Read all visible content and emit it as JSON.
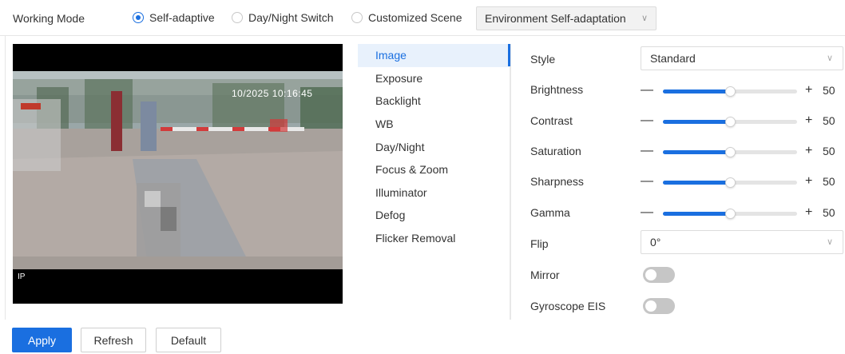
{
  "working_mode": {
    "label": "Working Mode",
    "options": [
      {
        "label": "Self-adaptive",
        "checked": true
      },
      {
        "label": "Day/Night Switch",
        "checked": false
      },
      {
        "label": "Customized Scene",
        "checked": false
      }
    ],
    "scene_select": "Environment Self-adaptation"
  },
  "video": {
    "osd_time": "10/2025 10:16:45",
    "osd_ip": "IP"
  },
  "menu": {
    "items": [
      "Image",
      "Exposure",
      "Backlight",
      "WB",
      "Day/Night",
      "Focus & Zoom",
      "Illuminator",
      "Defog",
      "Flicker Removal"
    ],
    "active": "Image"
  },
  "image": {
    "style": {
      "label": "Style",
      "value": "Standard"
    },
    "sliders": [
      {
        "label": "Brightness",
        "value": 50,
        "min": 0,
        "max": 100
      },
      {
        "label": "Contrast",
        "value": 50,
        "min": 0,
        "max": 100
      },
      {
        "label": "Saturation",
        "value": 50,
        "min": 0,
        "max": 100
      },
      {
        "label": "Sharpness",
        "value": 50,
        "min": 0,
        "max": 100
      },
      {
        "label": "Gamma",
        "value": 50,
        "min": 0,
        "max": 100
      }
    ],
    "flip": {
      "label": "Flip",
      "value": "0°"
    },
    "mirror": {
      "label": "Mirror",
      "on": false
    },
    "gyro": {
      "label": "Gyroscope EIS",
      "on": false
    }
  },
  "buttons": {
    "apply": "Apply",
    "refresh": "Refresh",
    "default": "Default"
  },
  "colors": {
    "accent": "#1a6fe0",
    "toggle_off": "#c6c6c6"
  }
}
